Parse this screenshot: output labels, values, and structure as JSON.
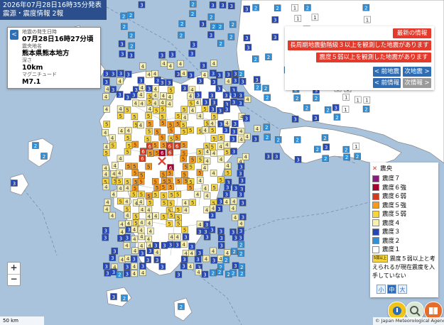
{
  "header": {
    "line1": "2026年07月28日16時35分発表",
    "line2": "震源・震度情報 2報"
  },
  "info": {
    "toggle_label": "<",
    "occurrence_label": "地震の発生日時",
    "occurrence_value": "07月28日16時27分頃",
    "region_label": "震央地名",
    "region_value": "熊本県熊本地方",
    "depth_label": "深さ",
    "depth_value": "10km",
    "magnitude_label": "マグニチュード",
    "magnitude_value": "M7.1"
  },
  "panel": {
    "latest_button": "最新の情報",
    "long_period_notice": "長周期地震動階級３以上を観測した地震があります",
    "intensity_notice": "震度５弱以上を観測した地震があります",
    "prev_quake": "< 前地震",
    "next_quake": "次地震 >",
    "prev_info": "< 前情報",
    "next_info": "次情報 >"
  },
  "legend": {
    "epicenter": "震央",
    "items": [
      {
        "label": "震度７",
        "color": "#8a1c7c",
        "mark": "7"
      },
      {
        "label": "震度６強",
        "color": "#a5002e",
        "mark": "6+"
      },
      {
        "label": "震度６弱",
        "color": "#d63a1e",
        "mark": "6-"
      },
      {
        "label": "震度５強",
        "color": "#f59a1f",
        "mark": "5+"
      },
      {
        "label": "震度５弱",
        "color": "#f7d33c",
        "mark": "5-"
      },
      {
        "label": "震度４",
        "color": "#f8f0b0",
        "mark": "4"
      },
      {
        "label": "震度３",
        "color": "#2447b5",
        "mark": "3"
      },
      {
        "label": "震度２",
        "color": "#2f8fd8",
        "mark": "2"
      },
      {
        "label": "震度１",
        "color": "#ffffff",
        "mark": "1"
      }
    ],
    "unknown_mark": "5弱以上",
    "unknown_note": "震度５弱以上と考えられるが現在震度を入手していない",
    "size_small": "小",
    "size_medium": "中",
    "size_large": "大"
  },
  "zoom": {
    "in": "+",
    "out": "−"
  },
  "scale_label": "50 km",
  "attribution": "© Japan Meteorological Agency",
  "colors": {
    "sea": "#a9c3dd",
    "land": "#ffffff",
    "title_bar": "#2b4f8c",
    "accent_red": "#e33a2c",
    "accent_blue": "#2e6db4"
  }
}
